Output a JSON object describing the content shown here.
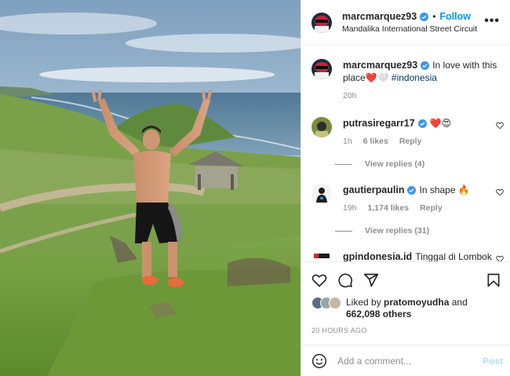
{
  "header": {
    "username": "marcmarquez93",
    "separator": "•",
    "follow_label": "Follow",
    "location": "Mandalika International Street Circuit",
    "more_label": "•••"
  },
  "caption": {
    "username": "marcmarquez93",
    "text_line1": "In love with this",
    "text_line2": "place",
    "emojis": "❤️🤍",
    "hashtag": "#indonesia",
    "time": "20h"
  },
  "comments": [
    {
      "username": "putrasiregarr17",
      "text": "❤️😍",
      "time": "1h",
      "likes": "6 likes",
      "reply_label": "Reply",
      "view_replies": "View replies (4)"
    },
    {
      "username": "gautierpaulin",
      "text": "In shape 🔥",
      "time": "19h",
      "likes": "1,174 likes",
      "reply_label": "Reply",
      "view_replies": "View replies (31)"
    },
    {
      "username": "gpindonesia.id",
      "text": "Tinggal di Lombok"
    }
  ],
  "likes": {
    "prefix": "Liked by",
    "liker": "pratomoyudha",
    "connector": "and",
    "count": "662,098 others"
  },
  "time_ago": "20 HOURS AGO",
  "comment_box": {
    "placeholder": "Add a comment...",
    "post_label": "Post"
  },
  "icons": [
    "verified-badge-icon",
    "more-options-icon",
    "heart-icon",
    "comment-icon",
    "share-icon",
    "bookmark-icon",
    "emoji-icon"
  ],
  "colors": {
    "accent": "#0095f6",
    "verified": "#3897f0",
    "muted": "#8e8e8e",
    "post_disabled": "#b2dffc"
  }
}
